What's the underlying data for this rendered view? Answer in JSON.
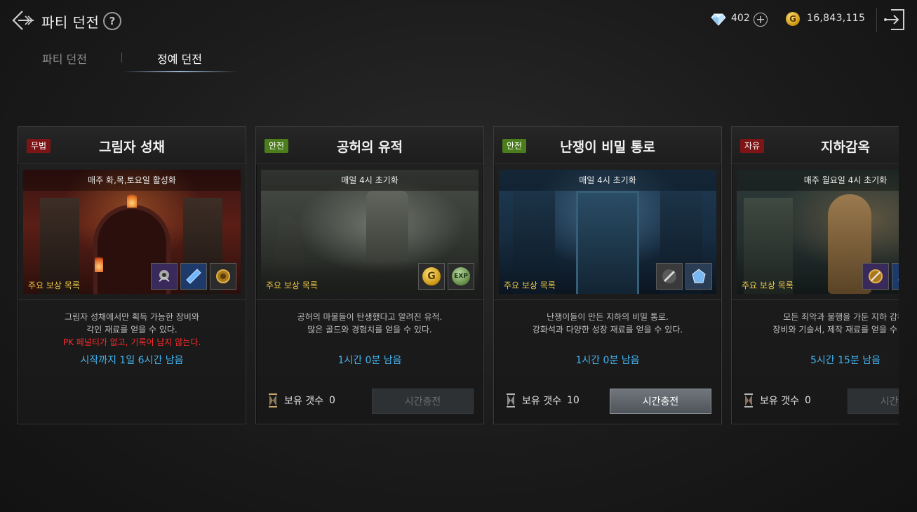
{
  "header": {
    "title": "파티 던전",
    "gem_count": "402",
    "gold_count": "16,843,115"
  },
  "tabs": [
    {
      "label": "파티 던전",
      "active": false
    },
    {
      "label": "정예 던전",
      "active": true
    }
  ],
  "cards": [
    {
      "badge": "무법",
      "badge_color": "#7d1517",
      "title": "그림자 성채",
      "reset": "매주 화,목,토요일 활성화",
      "reward_label": "주요 보상 목록",
      "desc1": "그림자 성채에서만 획득 가능한 장비와",
      "desc2": "각인 재료를 얻을 수 있다.",
      "warning": "PK 페널티가 없고, 기록이 남지 않는다.",
      "timer": "시작까지 1일 6시간 남음"
    },
    {
      "badge": "안전",
      "badge_color": "#4b7d1c",
      "title": "공허의 유적",
      "reset": "매일 4시 초기화",
      "reward_label": "주요 보상 목록",
      "desc1": "공허의 마물들이 탄생했다고 알려진 유적.",
      "desc2": "많은 골드와 경험치를 얻을 수 있다.",
      "timer": "1시간 0분 남음",
      "hold_label": "보유 갯수",
      "hold_count": "0",
      "button": "시간충전"
    },
    {
      "badge": "안전",
      "badge_color": "#4b7d1c",
      "title": "난쟁이 비밀 통로",
      "reset": "매일 4시 초기화",
      "reward_label": "주요 보상 목록",
      "desc1": "난쟁이들이 만든 지하의 비밀 통로.",
      "desc2": "강화석과 다양한 성장 재료를 얻을 수 있다.",
      "timer": "1시간 0분 남음",
      "hold_label": "보유 갯수",
      "hold_count": "10",
      "button": "시간충전"
    },
    {
      "badge": "자유",
      "badge_color": "#7d1517",
      "title": "지하감옥",
      "reset": "매주 월요일 4시 초기화",
      "reward_label": "주요 보상 목록",
      "desc1": "모든 죄악과 불행을 가둔 지하 감옥.",
      "desc2": "장비와 기술서, 제작 재료를 얻을 수 있다.",
      "timer": "5시간 15분 남음",
      "hold_label": "보유 갯수",
      "hold_count": "0",
      "button": "시간충전"
    }
  ]
}
